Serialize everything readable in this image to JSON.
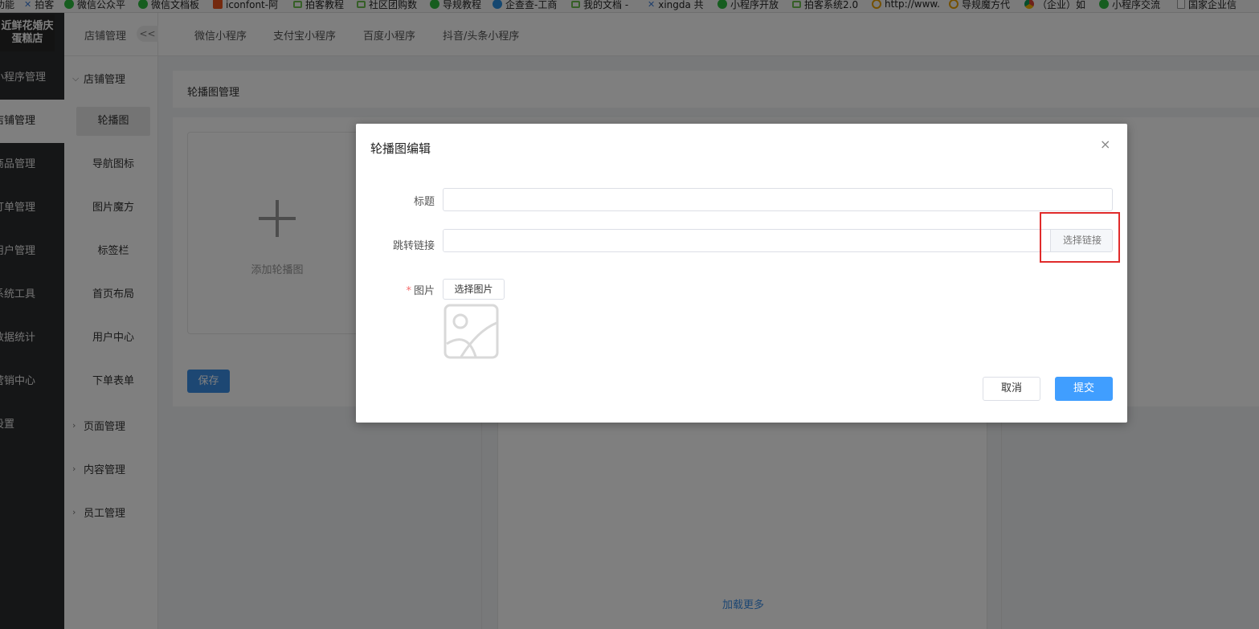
{
  "bookmarks": [
    {
      "label": "功能",
      "icon": "none"
    },
    {
      "label": "拍客",
      "icon": "x"
    },
    {
      "label": "微信公众平",
      "icon": "green"
    },
    {
      "label": "微信文档板",
      "icon": "green"
    },
    {
      "label": "iconfont-阿",
      "icon": "orange"
    },
    {
      "label": "拍客教程",
      "icon": "lgreen"
    },
    {
      "label": "社区团购数",
      "icon": "lgreen"
    },
    {
      "label": "导规教程",
      "icon": "green"
    },
    {
      "label": "企查查-工商",
      "icon": "blue"
    },
    {
      "label": "我的文档 -",
      "icon": "lgreen"
    },
    {
      "label": "xingda 共",
      "icon": "x"
    },
    {
      "label": "小程序开放",
      "icon": "green"
    },
    {
      "label": "拍客系统2.0",
      "icon": "lgreen"
    },
    {
      "label": "http://www.",
      "icon": "ring"
    },
    {
      "label": "导规魔方代",
      "icon": "ring"
    },
    {
      "label": "（企业）如",
      "icon": "chrome"
    },
    {
      "label": "小程序交流",
      "icon": "green"
    },
    {
      "label": "国家企业信",
      "icon": "doc"
    }
  ],
  "store": {
    "name_line1": "近鲜花婚庆",
    "name_line2": "蛋糕店"
  },
  "main_nav": [
    {
      "label": "小程序管理",
      "active": false
    },
    {
      "label": "店铺管理",
      "active": true
    },
    {
      "label": "商品管理",
      "active": false
    },
    {
      "label": "订单管理",
      "active": false
    },
    {
      "label": "用户管理",
      "active": false
    },
    {
      "label": "系统工具",
      "active": false
    },
    {
      "label": "数据统计",
      "active": false
    },
    {
      "label": "营销中心",
      "active": false
    },
    {
      "label": "设置",
      "active": false
    }
  ],
  "sub_nav": {
    "title": "店铺管理",
    "collapse_label": "<<",
    "open_group": "店铺管理",
    "items": [
      "轮播图",
      "导航图标",
      "图片魔方",
      "标签栏",
      "首页布局",
      "用户中心",
      "下单表单"
    ],
    "closed_groups": [
      "页面管理",
      "内容管理",
      "员工管理"
    ]
  },
  "top_tabs": [
    "微信小程序",
    "支付宝小程序",
    "百度小程序",
    "抖音/头条小程序"
  ],
  "page": {
    "breadcrumb": "轮播图管理",
    "add_label": "添加轮播图",
    "save_label": "保存",
    "load_more": "加载更多"
  },
  "modal": {
    "title": "轮播图编辑",
    "close": "×",
    "title_label": "标题",
    "title_value": "",
    "link_label": "跳转链接",
    "link_value": "",
    "select_link": "选择链接",
    "image_label": "图片",
    "image_required_mark": "*",
    "select_image": "选择图片",
    "cancel": "取消",
    "submit": "提交"
  },
  "colors": {
    "primary": "#409eff",
    "sidebar_dark": "#2b2d2f",
    "highlight_box": "#e02b2b",
    "required": "#f56c6c"
  }
}
